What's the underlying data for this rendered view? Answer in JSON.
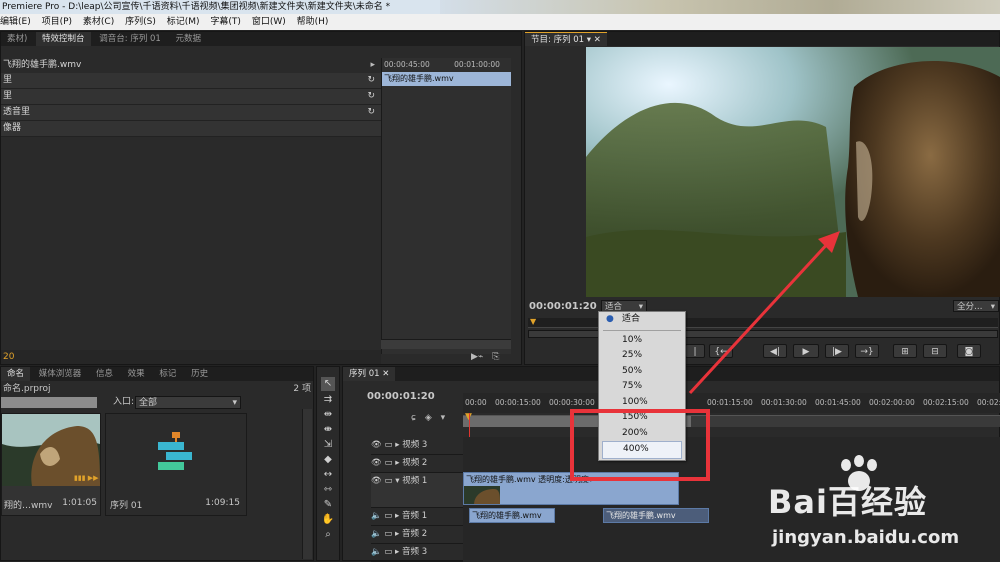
{
  "window": {
    "title": "Premiere Pro - D:\\leap\\公司宣传\\千语资料\\千语视频\\集团视频\\新建文件夹\\新建文件夹\\未命名 *"
  },
  "menu": [
    "编辑(E)",
    "项目(P)",
    "素材(C)",
    "序列(S)",
    "标记(M)",
    "字幕(T)",
    "窗口(W)",
    "帮助(H)"
  ],
  "source_panel": {
    "tabs": [
      "素材)",
      "特效控制台",
      "调音台: 序列 01",
      "元数据"
    ],
    "clip_title": "飞翔的雄手鹏.wmv",
    "effects": [
      "里",
      "里",
      "透音里",
      "像器"
    ],
    "timecodes": [
      "00:00:45:00",
      "00:01:00:00"
    ],
    "clip_chip": "飞翔的雄手鹏.wmv",
    "time": "20"
  },
  "program_monitor": {
    "tab": "节目: 序列 01",
    "timecode": "00:00:01:20",
    "zoom_value": "适合",
    "fit_button": "全分…",
    "zoom_menu": {
      "selected": "适合",
      "options": [
        "适合",
        "10%",
        "25%",
        "50%",
        "75%",
        "100%",
        "150%",
        "200%",
        "400%"
      ]
    }
  },
  "project_panel": {
    "tabs": [
      "命名",
      "媒体浏览器",
      "信息",
      "效果",
      "标记",
      "历史"
    ],
    "project_file": "命名.prproj",
    "item_count": "2 项",
    "in_label": "入口:",
    "in_value": "全部",
    "items": [
      {
        "name": "翔的…wmv",
        "duration": "1:01:05"
      },
      {
        "name": "序列 01",
        "duration": "1:09:15"
      }
    ]
  },
  "timeline": {
    "tab": "序列 01",
    "timecode": "00:00:01:20",
    "ruler": [
      "00:00",
      "00:00:15:00",
      "00:00:30:00",
      "00:01:15:00",
      "00:01:30:00",
      "00:01:45:00",
      "00:02:00:00",
      "00:02:15:00",
      "00:02:30"
    ],
    "tracks": {
      "video3": "视频 3",
      "video2": "视频 2",
      "video1": "视频 1",
      "audio1": "音频 1",
      "audio2": "音频 2",
      "audio3": "音频 3"
    },
    "video_clip": "飞翔的雄手鹏.wmv",
    "video_clip_label": "透明度:透明度▾",
    "audio_clips": [
      "飞翔的雄手鹏.wmv",
      "飞翔的雄手鹏.wmv"
    ]
  },
  "watermark": {
    "brand": "Bai百经验",
    "url": "jingyan.baidu.com"
  },
  "colors": {
    "accent": "#e0a22a",
    "annotation": "#e8333a",
    "clip": "#8aa6cf"
  }
}
